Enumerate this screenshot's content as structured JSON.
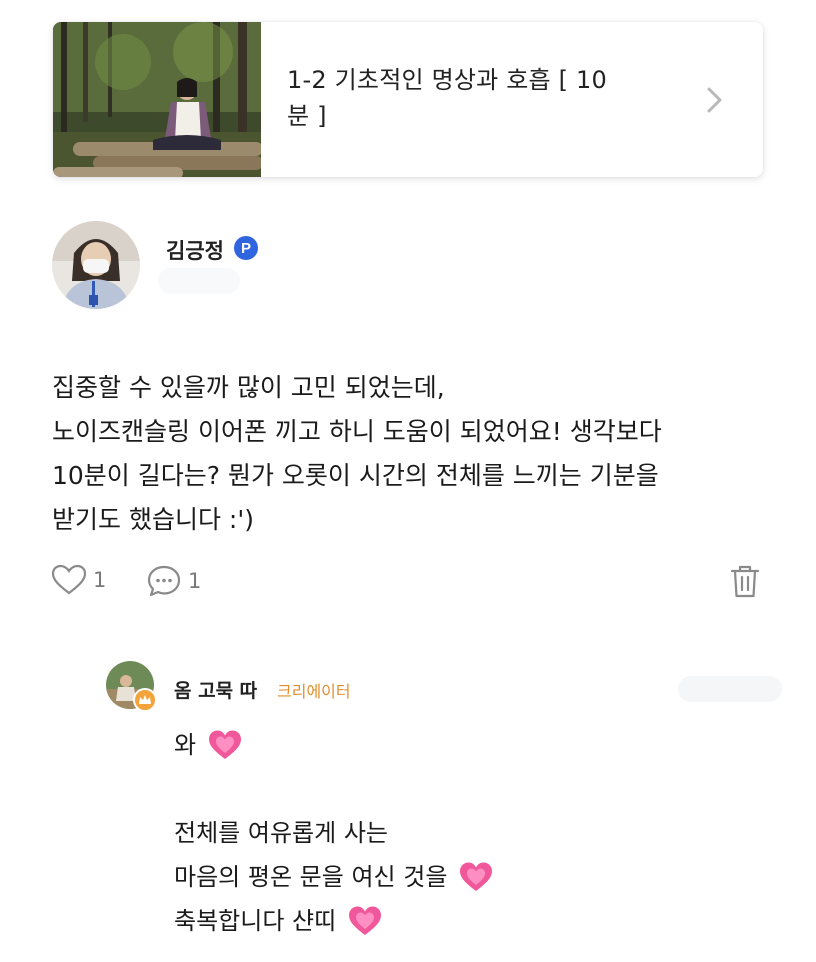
{
  "post_card": {
    "title_line1": "1-2 기초적인 명상과 호흡 [ 10",
    "title_line2": "분 ]",
    "thumbnail_icon": "meditation-forest-photo",
    "chevron_icon": "chevron-right-icon"
  },
  "comment": {
    "author_name": "김긍정",
    "badge_text": "P",
    "badge_color": "#2f66e0",
    "body": "집중할 수 있을까 많이 고민 되었는데,\n노이즈캔슬링 이어폰 끼고 하니 도움이 되었어요! 생각보다\n10분이 길다는? 뭔가 오롯이 시간의 전체를 느끼는 기분을\n받기도 했습니다 :')",
    "like_count": "1",
    "reply_count": "1"
  },
  "reply": {
    "author_name": "옴 고묵 따",
    "role_label": "크리에이터",
    "role_color": "#e0912f",
    "lines": [
      "와",
      "",
      "전체를 여유롭게 사는",
      "마음의 평온 문을 여신 것을",
      "축복합니다 샨띠"
    ]
  }
}
